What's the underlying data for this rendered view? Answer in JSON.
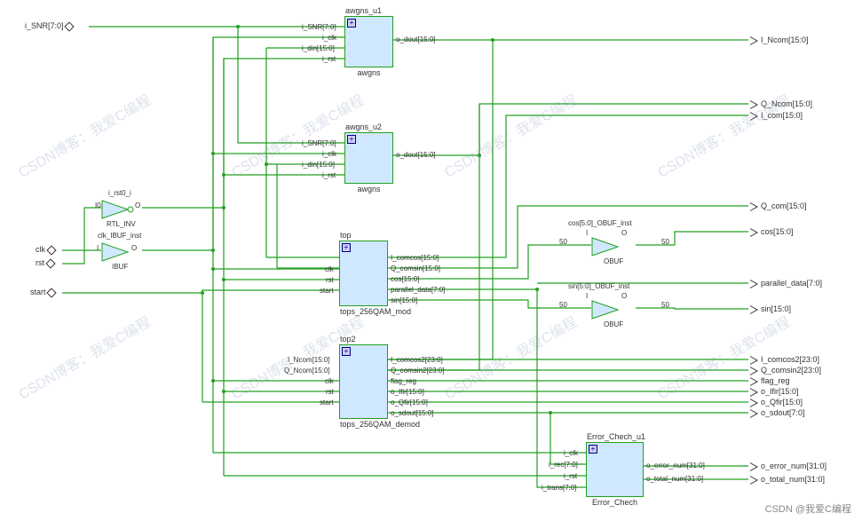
{
  "inputs": {
    "i_snr": "i_SNR[7:0]",
    "clk": "clk",
    "rst": "rst",
    "start": "start"
  },
  "outputs": {
    "i_ncom": "I_Ncom[15:0]",
    "q_ncom": "Q_Ncom[15:0]",
    "i_com": "I_com[15:0]",
    "q_com": "Q_com[15:0]",
    "cos": "cos[15:0]",
    "parallel_data": "parallel_data[7:0]",
    "sin": "sin[15:0]",
    "i_comcos2": "I_comcos2[23:0]",
    "q_comsin2": "Q_comsin2[23:0]",
    "flag_reg": "flag_reg",
    "o_ifir": "o_Ifir[15:0]",
    "o_qfir": "o_Qfir[15:0]",
    "o_sdout": "o_sdout[7:0]",
    "o_error_num": "o_error_num[31:0]",
    "o_total_num": "o_total_num[31:0]"
  },
  "blocks": {
    "awgns_u1": {
      "title": "awgns_u1",
      "footer": "awgns",
      "pins_l": [
        "i_SNR[7:0]",
        "i_clk",
        "i_din[15:0]",
        "i_rst"
      ],
      "pins_r": [
        "o_dout[15:0]"
      ]
    },
    "awgns_u2": {
      "title": "awgns_u2",
      "footer": "awgns",
      "pins_l": [
        "i_SNR[7:0]",
        "i_clk",
        "i_din[15:0]",
        "i_rst"
      ],
      "pins_r": [
        "o_dout[15:0]"
      ]
    },
    "rtl_inv": {
      "title": "i_rst0_i",
      "footer": "RTL_INV",
      "pin_i": "I0",
      "pin_o": "O"
    },
    "ibuf": {
      "title": "clk_IBUF_inst",
      "footer": "IBUF",
      "pin_i": "I",
      "pin_o": "O"
    },
    "top": {
      "title": "top",
      "footer": "tops_256QAM_mod",
      "pins_l": [
        "clk",
        "rst",
        "start"
      ],
      "pins_r": [
        "I_comcos[15:0]",
        "Q_comsin[15:0]",
        "cos[15:0]",
        "parallel_data[7:0]",
        "sin[15:0]"
      ]
    },
    "top2": {
      "title": "top2",
      "footer": "tops_256QAM_demod",
      "pins_l": [
        "I_Ncom[15:0]",
        "Q_Ncom[15:0]",
        "clk",
        "rst",
        "start"
      ],
      "pins_r": [
        "I_comcos2[23:0]",
        "Q_comsin2[23:0]",
        "flag_reg",
        "o_Ifir[15:0]",
        "o_Qfir[15:0]",
        "o_sdout[15:0]"
      ]
    },
    "obuf_cos": {
      "title": "cos[5:0]_OBUF_inst",
      "footer": "OBUF",
      "pin_i": "I",
      "pin_o": "O"
    },
    "obuf_sin": {
      "title": "sin[5:0]_OBUF_inst",
      "footer": "OBUF",
      "pin_i": "I",
      "pin_o": "O"
    },
    "error_chech": {
      "title": "Error_Chech_u1",
      "footer": "Error_Chech",
      "pins_l": [
        "i_clk",
        "i_rec[7:0]",
        "i_rst",
        "i_trans[7:0]"
      ],
      "pins_r": [
        "o_error_num[31:0]",
        "o_total_num[31:0]"
      ]
    }
  },
  "bus_width_50": "50",
  "watermarks": "CSDN博客：我爱C编程",
  "watermark_footer": "CSDN @我爱C编程"
}
